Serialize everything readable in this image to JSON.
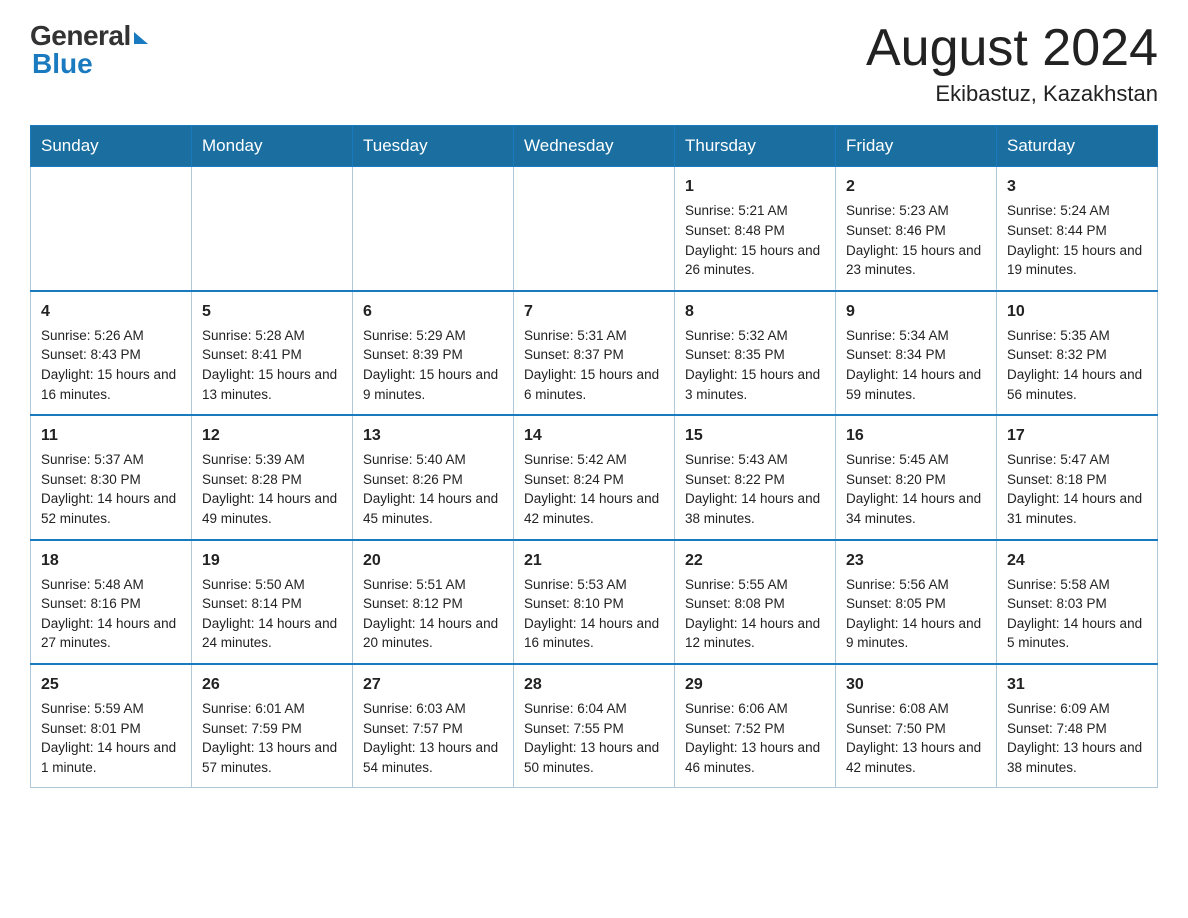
{
  "header": {
    "logo_general": "General",
    "logo_blue": "Blue",
    "month_title": "August 2024",
    "location": "Ekibastuz, Kazakhstan"
  },
  "days_of_week": [
    "Sunday",
    "Monday",
    "Tuesday",
    "Wednesday",
    "Thursday",
    "Friday",
    "Saturday"
  ],
  "weeks": [
    [
      {
        "day": "",
        "info": ""
      },
      {
        "day": "",
        "info": ""
      },
      {
        "day": "",
        "info": ""
      },
      {
        "day": "",
        "info": ""
      },
      {
        "day": "1",
        "info": "Sunrise: 5:21 AM\nSunset: 8:48 PM\nDaylight: 15 hours and 26 minutes."
      },
      {
        "day": "2",
        "info": "Sunrise: 5:23 AM\nSunset: 8:46 PM\nDaylight: 15 hours and 23 minutes."
      },
      {
        "day": "3",
        "info": "Sunrise: 5:24 AM\nSunset: 8:44 PM\nDaylight: 15 hours and 19 minutes."
      }
    ],
    [
      {
        "day": "4",
        "info": "Sunrise: 5:26 AM\nSunset: 8:43 PM\nDaylight: 15 hours and 16 minutes."
      },
      {
        "day": "5",
        "info": "Sunrise: 5:28 AM\nSunset: 8:41 PM\nDaylight: 15 hours and 13 minutes."
      },
      {
        "day": "6",
        "info": "Sunrise: 5:29 AM\nSunset: 8:39 PM\nDaylight: 15 hours and 9 minutes."
      },
      {
        "day": "7",
        "info": "Sunrise: 5:31 AM\nSunset: 8:37 PM\nDaylight: 15 hours and 6 minutes."
      },
      {
        "day": "8",
        "info": "Sunrise: 5:32 AM\nSunset: 8:35 PM\nDaylight: 15 hours and 3 minutes."
      },
      {
        "day": "9",
        "info": "Sunrise: 5:34 AM\nSunset: 8:34 PM\nDaylight: 14 hours and 59 minutes."
      },
      {
        "day": "10",
        "info": "Sunrise: 5:35 AM\nSunset: 8:32 PM\nDaylight: 14 hours and 56 minutes."
      }
    ],
    [
      {
        "day": "11",
        "info": "Sunrise: 5:37 AM\nSunset: 8:30 PM\nDaylight: 14 hours and 52 minutes."
      },
      {
        "day": "12",
        "info": "Sunrise: 5:39 AM\nSunset: 8:28 PM\nDaylight: 14 hours and 49 minutes."
      },
      {
        "day": "13",
        "info": "Sunrise: 5:40 AM\nSunset: 8:26 PM\nDaylight: 14 hours and 45 minutes."
      },
      {
        "day": "14",
        "info": "Sunrise: 5:42 AM\nSunset: 8:24 PM\nDaylight: 14 hours and 42 minutes."
      },
      {
        "day": "15",
        "info": "Sunrise: 5:43 AM\nSunset: 8:22 PM\nDaylight: 14 hours and 38 minutes."
      },
      {
        "day": "16",
        "info": "Sunrise: 5:45 AM\nSunset: 8:20 PM\nDaylight: 14 hours and 34 minutes."
      },
      {
        "day": "17",
        "info": "Sunrise: 5:47 AM\nSunset: 8:18 PM\nDaylight: 14 hours and 31 minutes."
      }
    ],
    [
      {
        "day": "18",
        "info": "Sunrise: 5:48 AM\nSunset: 8:16 PM\nDaylight: 14 hours and 27 minutes."
      },
      {
        "day": "19",
        "info": "Sunrise: 5:50 AM\nSunset: 8:14 PM\nDaylight: 14 hours and 24 minutes."
      },
      {
        "day": "20",
        "info": "Sunrise: 5:51 AM\nSunset: 8:12 PM\nDaylight: 14 hours and 20 minutes."
      },
      {
        "day": "21",
        "info": "Sunrise: 5:53 AM\nSunset: 8:10 PM\nDaylight: 14 hours and 16 minutes."
      },
      {
        "day": "22",
        "info": "Sunrise: 5:55 AM\nSunset: 8:08 PM\nDaylight: 14 hours and 12 minutes."
      },
      {
        "day": "23",
        "info": "Sunrise: 5:56 AM\nSunset: 8:05 PM\nDaylight: 14 hours and 9 minutes."
      },
      {
        "day": "24",
        "info": "Sunrise: 5:58 AM\nSunset: 8:03 PM\nDaylight: 14 hours and 5 minutes."
      }
    ],
    [
      {
        "day": "25",
        "info": "Sunrise: 5:59 AM\nSunset: 8:01 PM\nDaylight: 14 hours and 1 minute."
      },
      {
        "day": "26",
        "info": "Sunrise: 6:01 AM\nSunset: 7:59 PM\nDaylight: 13 hours and 57 minutes."
      },
      {
        "day": "27",
        "info": "Sunrise: 6:03 AM\nSunset: 7:57 PM\nDaylight: 13 hours and 54 minutes."
      },
      {
        "day": "28",
        "info": "Sunrise: 6:04 AM\nSunset: 7:55 PM\nDaylight: 13 hours and 50 minutes."
      },
      {
        "day": "29",
        "info": "Sunrise: 6:06 AM\nSunset: 7:52 PM\nDaylight: 13 hours and 46 minutes."
      },
      {
        "day": "30",
        "info": "Sunrise: 6:08 AM\nSunset: 7:50 PM\nDaylight: 13 hours and 42 minutes."
      },
      {
        "day": "31",
        "info": "Sunrise: 6:09 AM\nSunset: 7:48 PM\nDaylight: 13 hours and 38 minutes."
      }
    ]
  ]
}
